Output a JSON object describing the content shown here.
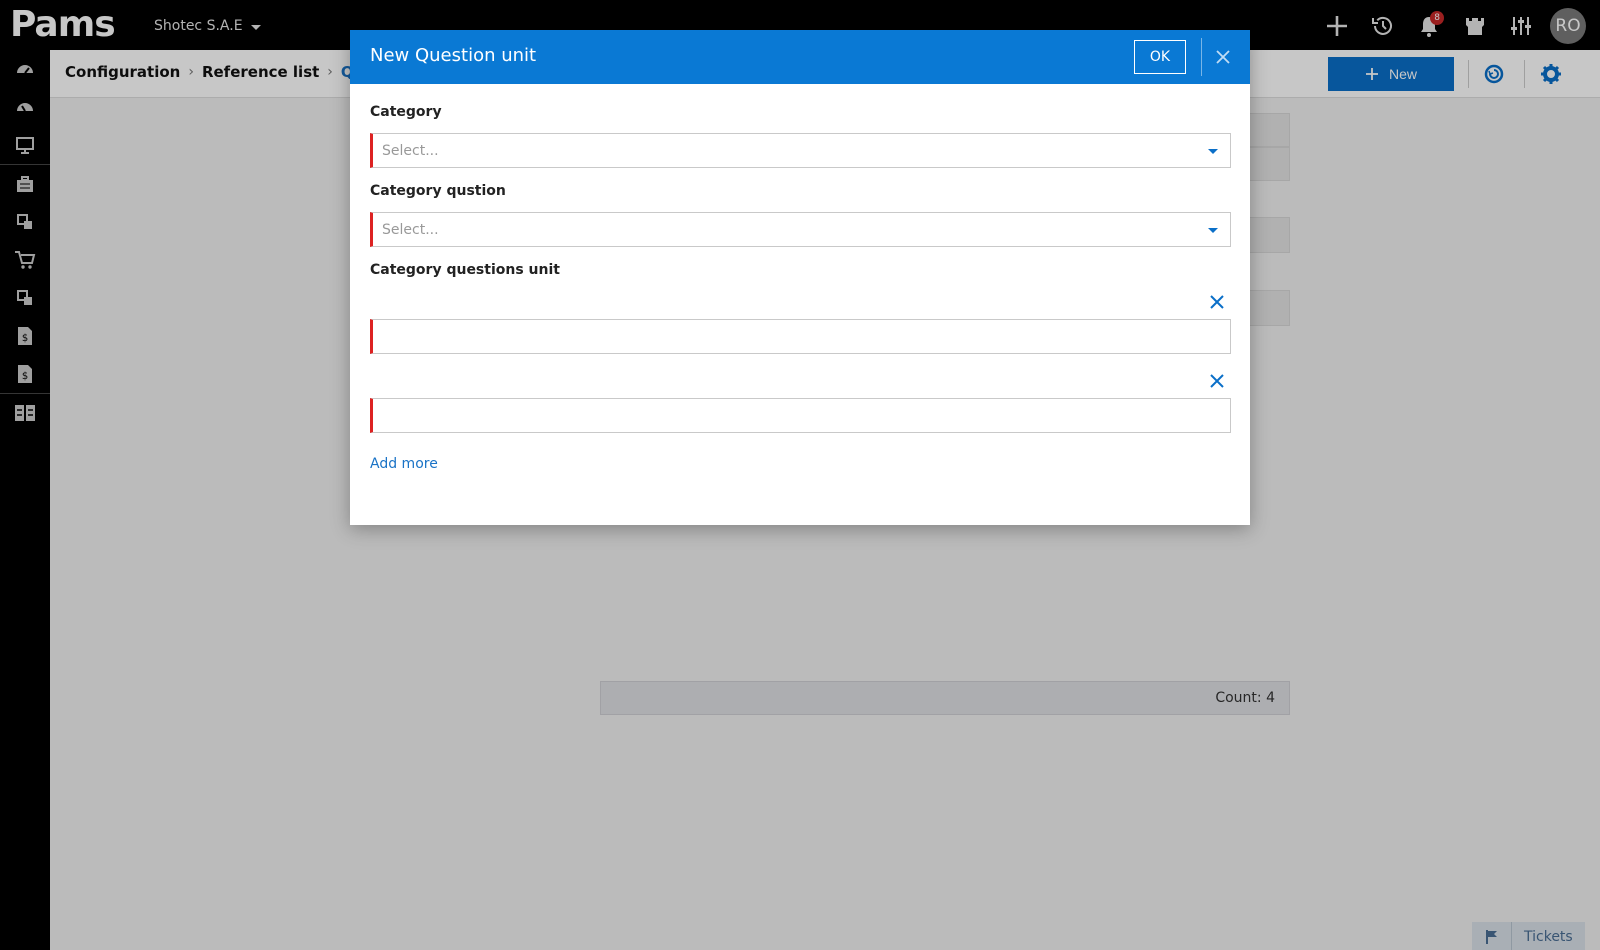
{
  "app": {
    "logo": "Pams",
    "company": "Shotec S.A.E",
    "notification_count": "8",
    "user_initials": "RO"
  },
  "top_icons": [
    "plus-icon",
    "history-icon",
    "bell-icon",
    "castle-icon",
    "sliders-icon"
  ],
  "sidebar": {
    "items": [
      "dashboard-icon",
      "dashboard-2-icon",
      "monitor-icon",
      "briefcase-icon",
      "modules-icon",
      "cart-icon",
      "modules-2-icon",
      "invoice-icon",
      "invoice-2-icon",
      "grid-config-icon"
    ]
  },
  "breadcrumb": {
    "items": [
      "Configuration",
      "Reference list"
    ],
    "current": "Ques"
  },
  "toolbar": {
    "new_label": "New"
  },
  "grid": {
    "count_label": "Count: 4"
  },
  "tickets": {
    "label": "Tickets"
  },
  "modal": {
    "title": "New Question unit",
    "ok_label": "OK",
    "fields": {
      "category_label": "Category",
      "category_placeholder": "Select...",
      "category_question_label": "Category qustion",
      "category_question_placeholder": "Select...",
      "units_label": "Category questions unit"
    },
    "add_more_label": "Add more"
  },
  "colors": {
    "accent": "#0a79d4",
    "required": "#dd2222",
    "link": "#1a73c6"
  }
}
